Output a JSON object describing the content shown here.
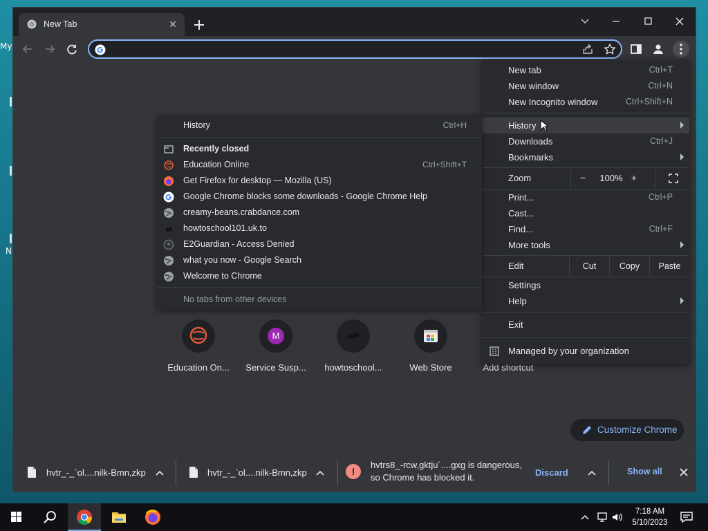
{
  "desktop": {
    "icon_labels": [
      "My",
      "N"
    ]
  },
  "window": {
    "tab": {
      "title": "New Tab",
      "favicon": "chrome-icon",
      "close": "✕"
    },
    "new_tab_glyph": "+",
    "controls": [
      "chevron-down-icon",
      "minimize-icon",
      "maximize-icon",
      "close-icon"
    ]
  },
  "toolbar": {
    "omnibox": {
      "value": "",
      "search_engine_icon": "google-g-icon"
    },
    "icons": [
      "back-icon",
      "forward-icon",
      "reload-icon",
      "share-icon",
      "star-icon",
      "side-panel-icon",
      "profile-icon",
      "kebab-menu-icon"
    ]
  },
  "shortcuts": [
    {
      "label": "Education On...",
      "icon": "education-online-icon"
    },
    {
      "label": "Service Susp...",
      "icon": "letter-m-icon",
      "letter": "M",
      "color": "#9c27b0"
    },
    {
      "label": "howtoschool...",
      "icon": "bat-icon"
    },
    {
      "label": "Web Store",
      "icon": "web-store-icon"
    },
    {
      "label": "Add shortcut",
      "icon": "add-icon"
    }
  ],
  "customize_button": {
    "label": "Customize Chrome"
  },
  "downloads": {
    "items": [
      {
        "name": "hvtr_-_`ol....nilk-Bmn,zkp"
      },
      {
        "name": "hvtr_-_`ol....nilk-Bmn,zkp"
      }
    ],
    "warning": {
      "glyph": "!",
      "line1": "hvtrs8_-rcw,gktju`....gxg is dangerous,",
      "line2": "so Chrome has blocked it.",
      "discard": "Discard"
    },
    "show_all": "Show all"
  },
  "main_menu": {
    "items": [
      {
        "label": "New tab",
        "shortcut": "Ctrl+T"
      },
      {
        "label": "New window",
        "shortcut": "Ctrl+N"
      },
      {
        "label": "New Incognito window",
        "shortcut": "Ctrl+Shift+N"
      },
      {
        "label": "History",
        "submenu": true
      },
      {
        "label": "Downloads",
        "shortcut": "Ctrl+J"
      },
      {
        "label": "Bookmarks",
        "submenu": true
      },
      {
        "label": "Print...",
        "shortcut": "Ctrl+P"
      },
      {
        "label": "Cast..."
      },
      {
        "label": "Find...",
        "shortcut": "Ctrl+F"
      },
      {
        "label": "More tools",
        "submenu": true
      },
      {
        "label": "Settings"
      },
      {
        "label": "Help",
        "submenu": true
      },
      {
        "label": "Exit"
      }
    ],
    "zoom": {
      "label": "Zoom",
      "minus": "−",
      "value": "100%",
      "plus": "+"
    },
    "edit": {
      "label": "Edit",
      "cut": "Cut",
      "copy": "Copy",
      "paste": "Paste"
    },
    "managed": "Managed by your organization"
  },
  "history_menu": {
    "header": {
      "label": "History",
      "shortcut": "Ctrl+H"
    },
    "recently_closed": "Recently closed",
    "entries": [
      {
        "label": "Education Online",
        "shortcut": "Ctrl+Shift+T",
        "icon": "education-online-icon"
      },
      {
        "label": "Get Firefox for desktop — Mozilla (US)",
        "icon": "firefox-icon"
      },
      {
        "label": "Google Chrome blocks some downloads - Google Chrome Help",
        "icon": "google-g-icon"
      },
      {
        "label": "creamy-beans.crabdance.com",
        "icon": "globe-icon"
      },
      {
        "label": "howtoschool101.uk.to",
        "icon": "bat-icon"
      },
      {
        "label": "E2Guardian - Access Denied",
        "icon": "github-icon"
      },
      {
        "label": "what you now - Google Search",
        "icon": "globe-icon"
      },
      {
        "label": "Welcome to Chrome",
        "icon": "globe-icon"
      }
    ],
    "no_other_devices": "No tabs from other devices"
  },
  "taskbar": {
    "items": [
      "windows-start-icon",
      "search-icon",
      "chrome-icon",
      "file-explorer-icon",
      "firefox-icon"
    ],
    "clock": {
      "time": "7:18 AM",
      "date": "5/10/2023"
    }
  }
}
